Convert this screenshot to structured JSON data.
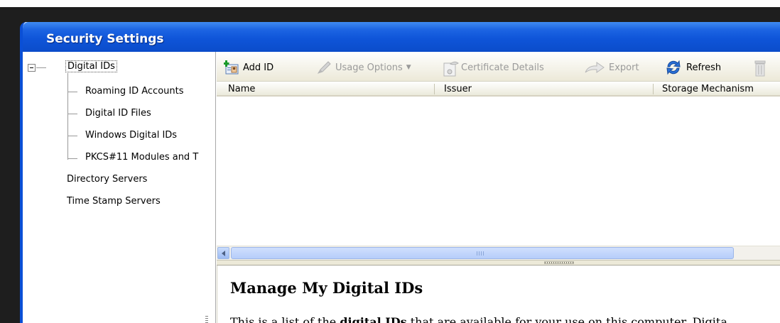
{
  "window": {
    "title": "Security Settings"
  },
  "tree": {
    "items": [
      {
        "label": "Digital IDs"
      },
      {
        "label": "Roaming ID Accounts"
      },
      {
        "label": "Digital ID Files"
      },
      {
        "label": "Windows Digital IDs"
      },
      {
        "label": "PKCS#11 Modules and T"
      },
      {
        "label": "Directory Servers"
      },
      {
        "label": "Time Stamp Servers"
      }
    ]
  },
  "toolbar": {
    "add_id": "Add ID",
    "usage_options": "Usage Options",
    "certificate_details": "Certificate Details",
    "export": "Export",
    "refresh": "Refresh"
  },
  "list": {
    "columns": [
      "Name",
      "Issuer",
      "Storage Mechanism"
    ]
  },
  "help": {
    "heading": "Manage My Digital IDs",
    "text_prefix": "This is a list of the ",
    "text_bold": "digital IDs",
    "text_suffix": " that are available for your use on this computer. Digita"
  },
  "colors": {
    "titlebar": "#0f55d9",
    "title_text": "#ffffff",
    "disabled_text": "#9a9a9a"
  }
}
